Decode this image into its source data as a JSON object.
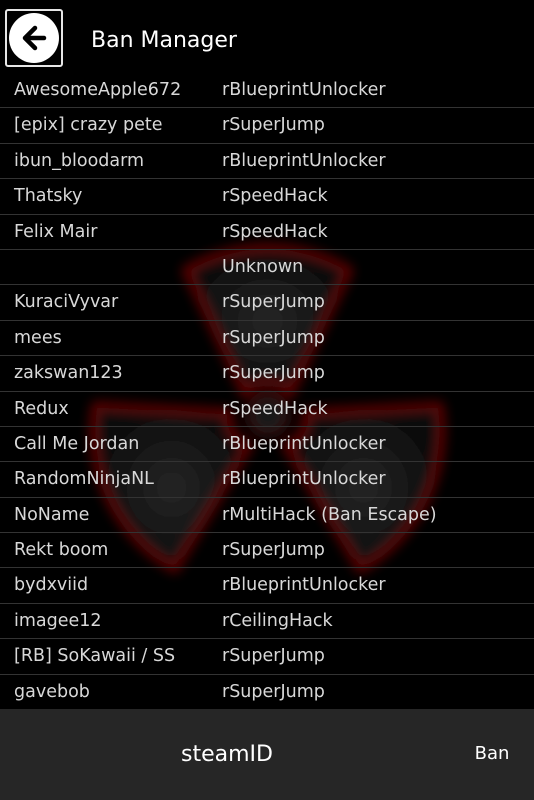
{
  "header": {
    "title": "Ban Manager",
    "back_icon": "arrow-left-icon"
  },
  "bans": [
    {
      "name": "AwesomeApple672",
      "reason": "rBlueprintUnlocker"
    },
    {
      "name": "[epix] crazy pete",
      "reason": "rSuperJump"
    },
    {
      "name": "ibun_bloodarm",
      "reason": "rBlueprintUnlocker"
    },
    {
      "name": "Thatsky",
      "reason": "rSpeedHack"
    },
    {
      "name": "Felix Mair",
      "reason": "rSpeedHack"
    },
    {
      "name": "",
      "reason": "Unknown"
    },
    {
      "name": "KuraciVyvar",
      "reason": "rSuperJump"
    },
    {
      "name": "mees",
      "reason": "rSuperJump"
    },
    {
      "name": "zakswan123",
      "reason": "rSuperJump"
    },
    {
      "name": "Redux",
      "reason": "rSpeedHack"
    },
    {
      "name": "Call Me Jordan",
      "reason": "rBlueprintUnlocker"
    },
    {
      "name": "RandomNinjaNL",
      "reason": "rBlueprintUnlocker"
    },
    {
      "name": "NoName",
      "reason": "rMultiHack (Ban Escape)"
    },
    {
      "name": "Rekt boom",
      "reason": "rSuperJump"
    },
    {
      "name": "bydxviid",
      "reason": "rBlueprintUnlocker"
    },
    {
      "name": "imagee12",
      "reason": "rCeilingHack"
    },
    {
      "name": "[RB] SoKawaii / SS",
      "reason": "rSuperJump"
    },
    {
      "name": "gavebob",
      "reason": "rSuperJump"
    }
  ],
  "footer": {
    "steamid_placeholder": "steamID",
    "steamid_value": "",
    "ban_label": "Ban"
  },
  "colors": {
    "background": "#000000",
    "footer": "#262626",
    "text": "#d8d8d8",
    "emblem_red": "#8b0000"
  }
}
